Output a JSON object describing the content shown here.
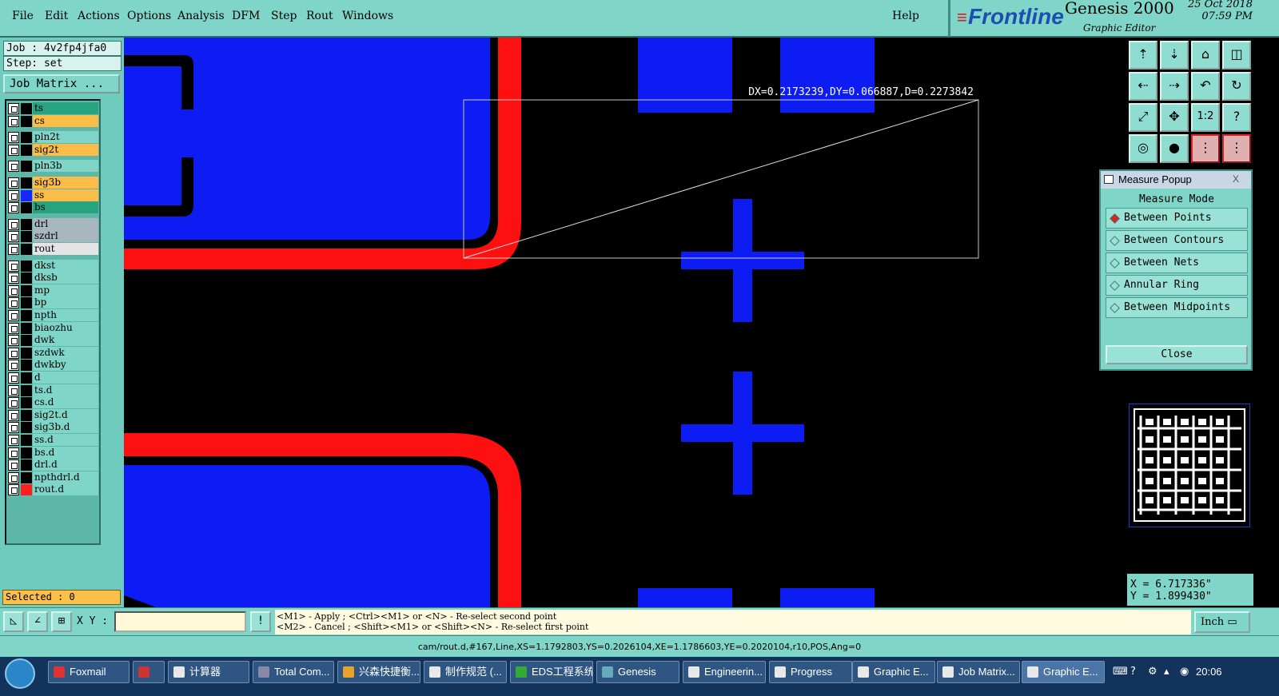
{
  "menu": {
    "file": "File",
    "edit": "Edit",
    "actions": "Actions",
    "options": "Options",
    "analysis": "Analysis",
    "dfm": "DFM",
    "step": "Step",
    "rout": "Rout",
    "windows": "Windows",
    "help": "Help"
  },
  "brand": {
    "logo": "Frontline",
    "product": "Genesis 2000",
    "subtitle": "Graphic Editor",
    "date": "25 Oct 2018",
    "time": "07:59 PM"
  },
  "job": {
    "job_label": "Job : 4v2fp4jfa0",
    "step_label": "Step: set",
    "matrix_button": "Job Matrix ..."
  },
  "layers": [
    {
      "name": "ts",
      "color": "#27a37f",
      "swatch": "#000000"
    },
    {
      "name": "cs",
      "color": "#fbbd47",
      "swatch": "#000000"
    },
    {
      "name": "pln2t",
      "color": "#7fd6c8",
      "swatch": "#000000"
    },
    {
      "name": "sig2t",
      "color": "#fbbd47",
      "swatch": "#000000"
    },
    {
      "name": "pln3b",
      "color": "#7fd6c8",
      "swatch": "#000000"
    },
    {
      "name": "sig3b",
      "color": "#fbbd47",
      "swatch": "#000000"
    },
    {
      "name": "ss",
      "color": "#fbbd47",
      "swatch": "#1a24ff"
    },
    {
      "name": "bs",
      "color": "#27a37f",
      "swatch": "#000000"
    },
    {
      "name": "drl",
      "color": "#a8b7bd",
      "swatch": "#000000"
    },
    {
      "name": "szdrl",
      "color": "#a8b7bd",
      "swatch": "#000000"
    },
    {
      "name": "rout",
      "color": "#e4e4e4",
      "swatch": "#000000"
    },
    {
      "name": "dkst",
      "color": "#7fd6c8",
      "swatch": "#000000"
    },
    {
      "name": "dksb",
      "color": "#7fd6c8",
      "swatch": "#000000"
    },
    {
      "name": "mp",
      "color": "#7fd6c8",
      "swatch": "#000000"
    },
    {
      "name": "bp",
      "color": "#7fd6c8",
      "swatch": "#000000"
    },
    {
      "name": "npth",
      "color": "#7fd6c8",
      "swatch": "#000000"
    },
    {
      "name": "biaozhu",
      "color": "#7fd6c8",
      "swatch": "#000000"
    },
    {
      "name": "dwk",
      "color": "#7fd6c8",
      "swatch": "#000000"
    },
    {
      "name": "szdwk",
      "color": "#7fd6c8",
      "swatch": "#000000"
    },
    {
      "name": "dwkby",
      "color": "#7fd6c8",
      "swatch": "#000000"
    },
    {
      "name": "d",
      "color": "#7fd6c8",
      "swatch": "#000000"
    },
    {
      "name": "ts.d",
      "color": "#7fd6c8",
      "swatch": "#000000"
    },
    {
      "name": "cs.d",
      "color": "#7fd6c8",
      "swatch": "#000000"
    },
    {
      "name": "sig2t.d",
      "color": "#7fd6c8",
      "swatch": "#000000"
    },
    {
      "name": "sig3b.d",
      "color": "#7fd6c8",
      "swatch": "#000000"
    },
    {
      "name": "ss.d",
      "color": "#7fd6c8",
      "swatch": "#000000"
    },
    {
      "name": "bs.d",
      "color": "#7fd6c8",
      "swatch": "#000000"
    },
    {
      "name": "drl.d",
      "color": "#7fd6c8",
      "swatch": "#000000"
    },
    {
      "name": "npthdrl.d",
      "color": "#7fd6c8",
      "swatch": "#000000"
    },
    {
      "name": "rout.d",
      "color": "#7fd6c8",
      "swatch": "#ff2020"
    }
  ],
  "selected": "Selected : 0",
  "canvas": {
    "measure_readout": "DX=0.2173239,DY=0.066887,D=0.2273842",
    "copper_color": "#0c1cf2",
    "rout_color": "#ff1010"
  },
  "measure_popup": {
    "title": "Measure Popup",
    "close_x": "X",
    "mode_label": "Measure Mode",
    "options": [
      "Between Points",
      "Between Contours",
      "Between Nets",
      "Annular Ring",
      "Between Midpoints"
    ],
    "selected": "Between Points",
    "close_button": "Close"
  },
  "coords": {
    "x": "X = 6.717336\"",
    "y": "Y = 1.899430\""
  },
  "command": {
    "xy_label": "X Y :",
    "xy_value": "",
    "help_line1": "<M1> - Apply  ; <Ctrl><M1> or <N> - Re-select second point",
    "help_line2": "<M2> - Cancel ; <Shift><M1> or <Shift><N> - Re-select first point",
    "unit": "Inch"
  },
  "status": "cam/rout.d,#167,Line,XS=1.1792803,YS=0.2026104,XE=1.1786603,YE=0.2020104,r10,POS,Ang=0",
  "taskbar": {
    "items": [
      "Foxmail",
      "",
      "计算器",
      "Total Com...",
      "兴森快捷衡...",
      "制作规范 (...",
      "EDS工程系统",
      "Genesis",
      "Engineerin...",
      "Progress",
      "Graphic E...",
      "Job Matrix...",
      "Graphic E..."
    ],
    "clock": "20:06"
  }
}
